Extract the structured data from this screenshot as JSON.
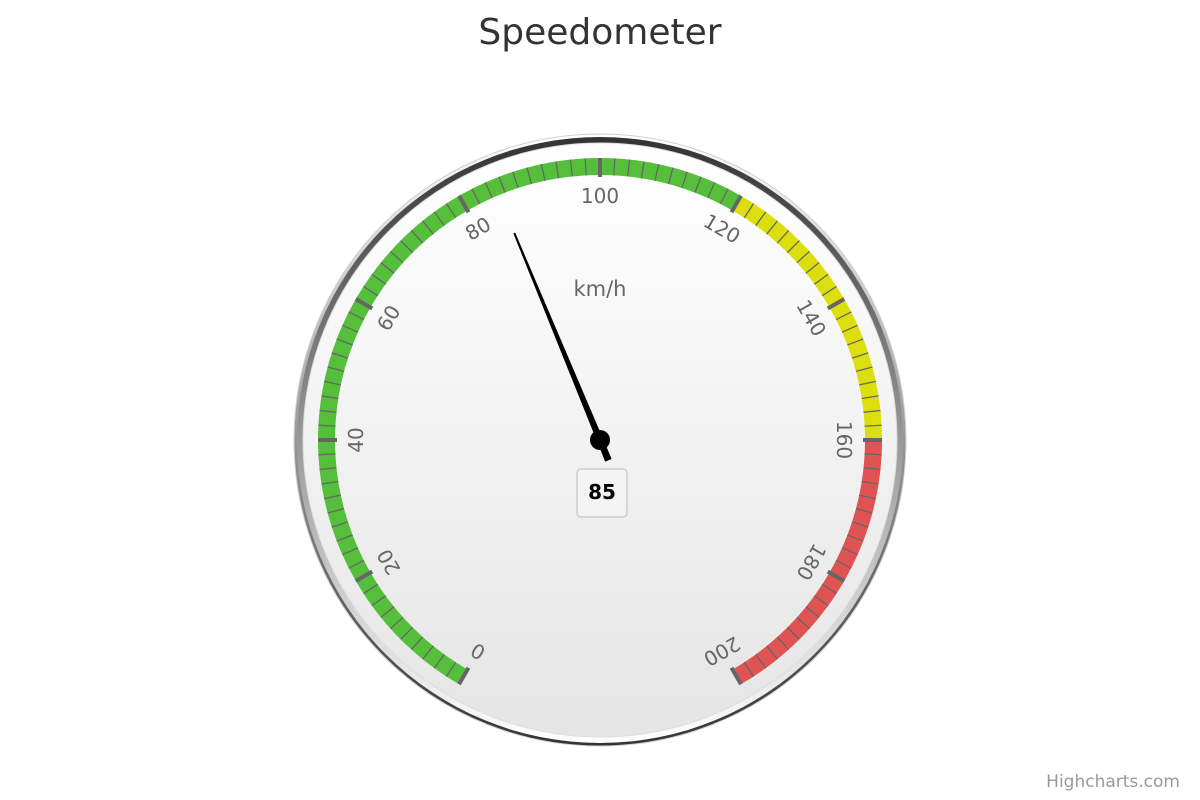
{
  "chart_data": {
    "type": "gauge",
    "title": "Speedometer",
    "unit_label": "km/h",
    "value": 85,
    "min": 0,
    "max": 200,
    "start_angle": -150,
    "end_angle": 150,
    "major_tick_interval": 20,
    "minor_tick_interval": 2,
    "tick_labels": [
      "0",
      "20",
      "40",
      "60",
      "80",
      "100",
      "120",
      "140",
      "160",
      "180",
      "200"
    ],
    "bands": [
      {
        "from": 0,
        "to": 120,
        "color": "#55BF3B"
      },
      {
        "from": 120,
        "to": 160,
        "color": "#DDDF0D"
      },
      {
        "from": 160,
        "to": 200,
        "color": "#DF5353"
      }
    ]
  },
  "credits": "Highcharts.com"
}
